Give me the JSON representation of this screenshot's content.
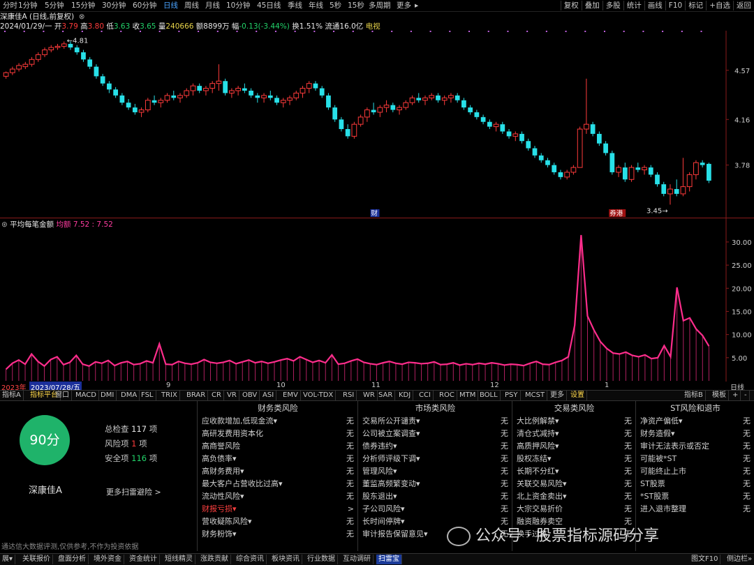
{
  "toolbar": {
    "periods": [
      "分时",
      "1分钟",
      "5分钟",
      "15分钟",
      "30分钟",
      "60分钟",
      "日线",
      "周线",
      "月线",
      "10分钟",
      "45日线",
      "季线",
      "年线",
      "5秒",
      "15秒",
      "多周期",
      "更多"
    ],
    "active_period": "日线",
    "right_tools": [
      "复权",
      "叠加",
      "多股",
      "统计",
      "画线",
      "F10",
      "标记",
      "+自选",
      "返回"
    ]
  },
  "stock": {
    "title": "深康佳A (日线,前复权)",
    "date": "2024/01/29/一",
    "open_label": "开",
    "open": "3.79",
    "high_label": "高",
    "high": "3.80",
    "low_label": "低",
    "low": "3.63",
    "close_label": "收",
    "close": "3.65",
    "vol_label": "量",
    "vol": "240666",
    "amount_label": "额",
    "amount": "8899万",
    "change_label": "幅",
    "change": "-0.13(-3.44%)",
    "turnover_label": "换",
    "turnover": "1.51%",
    "float_label": "流通",
    "float": "16.0亿",
    "news": "电视"
  },
  "price_panel": {
    "axis_labels": [
      "4.57",
      "4.16",
      "3.78"
    ],
    "high_mark": "4.81",
    "low_mark": "3.45",
    "event_tags": [
      "财",
      "券港"
    ]
  },
  "indicator": {
    "name": "平均每笔金额",
    "series_label": "均额",
    "values_text": "7.52 : 7.52",
    "axis_labels": [
      "30.00",
      "25.00",
      "20.00",
      "15.00",
      "10.00",
      "5.00"
    ]
  },
  "date_bar": {
    "year_label": "2023年",
    "cursor_date": "2023/07/28/五",
    "month_labels": [
      "9",
      "10",
      "11",
      "12",
      "1"
    ],
    "right_label": "日线"
  },
  "indicator_tabs": [
    "指标A",
    "指标平台",
    "窗口",
    "MACD",
    "DMI",
    "DMA",
    "FSL",
    "TRIX",
    "BRAR",
    "CR",
    "VR",
    "OBV",
    "ASI",
    "EMV",
    "VOL-TDX",
    "RSI",
    "WR",
    "SAR",
    "KDJ",
    "CCI",
    "ROC",
    "MTM",
    "BOLL",
    "PSY",
    "MCST",
    "更多",
    "设置"
  ],
  "indicator_tabs_right": [
    "指标B",
    "模板",
    "+",
    "-"
  ],
  "scan_summary": {
    "score": "90分",
    "name": "深康佳A",
    "total_label": "总检查",
    "total_value": "117",
    "total_unit": "项",
    "risk_label": "风险项",
    "risk_value": "1",
    "risk_unit": "项",
    "safe_label": "安全项",
    "safe_value": "116",
    "safe_unit": "项",
    "more_link": "更多扫雷避险 >"
  },
  "scan_columns": [
    {
      "title": "财务类风险",
      "rows": [
        {
          "label": "应收款增加,低现金流▾",
          "value": "无"
        },
        {
          "label": "高研发费用资本化",
          "value": "无"
        },
        {
          "label": "高商誉风险",
          "value": "无"
        },
        {
          "label": "高负债率▾",
          "value": "无"
        },
        {
          "label": "高财务费用▾",
          "value": "无"
        },
        {
          "label": "最大客户占营收比过高▾",
          "value": "无"
        },
        {
          "label": "流动性风险▾",
          "value": "无"
        },
        {
          "label": "财报亏损▾",
          "value": ">",
          "risk": true
        },
        {
          "label": "营收疑陈风险▾",
          "value": "无"
        },
        {
          "label": "财务粉饰▾",
          "value": "无"
        }
      ]
    },
    {
      "title": "市场类风险",
      "rows": [
        {
          "label": "交易所公开谴责▾",
          "value": "无"
        },
        {
          "label": "公司被立案调查▾",
          "value": "无"
        },
        {
          "label": "债券违约▾",
          "value": "无"
        },
        {
          "label": "分析师评级下调▾",
          "value": "无"
        },
        {
          "label": "管理风险▾",
          "value": "无"
        },
        {
          "label": "董监高频繁变动▾",
          "value": "无"
        },
        {
          "label": "股东退出▾",
          "value": "无"
        },
        {
          "label": "子公司风险▾",
          "value": "无"
        },
        {
          "label": "长时间停牌▾",
          "value": "无"
        },
        {
          "label": "审计报告保留意见▾",
          "value": "无"
        }
      ]
    },
    {
      "title": "交易类风险",
      "rows": [
        {
          "label": "大比例解禁▾",
          "value": "无"
        },
        {
          "label": "清仓式减持▾",
          "value": "无"
        },
        {
          "label": "高质押风险▾",
          "value": "无"
        },
        {
          "label": "股权冻结▾",
          "value": "无"
        },
        {
          "label": "长期不分红▾",
          "value": "无"
        },
        {
          "label": "关联交易风险▾",
          "value": "无"
        },
        {
          "label": "北上资金卖出▾",
          "value": "无"
        },
        {
          "label": "大宗交易折价",
          "value": "无"
        },
        {
          "label": "融资融券卖空",
          "value": "无"
        },
        {
          "label": "换手过高",
          "value": "无"
        }
      ]
    },
    {
      "title": "ST风险和退市",
      "rows": [
        {
          "label": "净资产偏低▾",
          "value": "无"
        },
        {
          "label": "财务造假▾",
          "value": "无"
        },
        {
          "label": "审计无法表示或否定",
          "value": "无"
        },
        {
          "label": "可能被*ST",
          "value": "无"
        },
        {
          "label": "可能终止上市",
          "value": "无"
        },
        {
          "label": "ST股票",
          "value": "无"
        },
        {
          "label": "*ST股票",
          "value": "无"
        },
        {
          "label": "进入退市整理",
          "value": "无"
        }
      ]
    }
  ],
  "disclaimer": "通达信大数据评测,仅供参考,不作为投资依据",
  "watermark": "公众号 · 股票指标源码分享",
  "bottom_tabs": [
    "展▾",
    "关联报价",
    "盘面分析",
    "境外资金",
    "资金统计",
    "短线精灵",
    "涨跌贡献",
    "综合资讯",
    "板块资讯",
    "行业数据",
    "互动调研",
    "扫雷宝"
  ],
  "bottom_right": [
    "图文F10",
    "侧边栏»"
  ],
  "colors": {
    "up": "#ff3b3b",
    "down": "#28e0e8",
    "indicator": "#ff2d8c",
    "score_circle": "#1fb36a"
  },
  "chart_data": [
    {
      "type": "candlestick",
      "title": "深康佳A (日线,前复权)",
      "ylim": [
        3.4,
        4.9
      ],
      "y_ticks": [
        4.57,
        4.16,
        3.78
      ],
      "annotations": [
        {
          "text": "4.81",
          "type": "high"
        },
        {
          "text": "3.45",
          "type": "low"
        }
      ],
      "ohlc": [
        [
          4.52,
          4.56,
          4.5,
          4.55
        ],
        [
          4.55,
          4.6,
          4.53,
          4.58
        ],
        [
          4.58,
          4.63,
          4.56,
          4.61
        ],
        [
          4.6,
          4.64,
          4.58,
          4.62
        ],
        [
          4.62,
          4.68,
          4.6,
          4.66
        ],
        [
          4.66,
          4.72,
          4.64,
          4.7
        ],
        [
          4.7,
          4.76,
          4.68,
          4.74
        ],
        [
          4.74,
          4.78,
          4.72,
          4.76
        ],
        [
          4.76,
          4.79,
          4.74,
          4.77
        ],
        [
          4.77,
          4.81,
          4.75,
          4.79
        ],
        [
          4.79,
          4.81,
          4.74,
          4.76
        ],
        [
          4.76,
          4.78,
          4.7,
          4.72
        ],
        [
          4.72,
          4.74,
          4.64,
          4.66
        ],
        [
          4.66,
          4.68,
          4.58,
          4.6
        ],
        [
          4.6,
          4.62,
          4.5,
          4.52
        ],
        [
          4.52,
          4.54,
          4.44,
          4.46
        ],
        [
          4.46,
          4.48,
          4.38,
          4.41
        ],
        [
          4.41,
          4.43,
          4.34,
          4.36
        ],
        [
          4.36,
          4.38,
          4.28,
          4.3
        ],
        [
          4.3,
          4.33,
          4.24,
          4.26
        ],
        [
          4.26,
          4.29,
          4.2,
          4.22
        ],
        [
          4.22,
          4.26,
          4.18,
          4.24
        ],
        [
          4.24,
          4.34,
          4.22,
          4.32
        ],
        [
          4.32,
          4.36,
          4.28,
          4.3
        ],
        [
          4.3,
          4.34,
          4.26,
          4.32
        ],
        [
          4.32,
          4.38,
          4.3,
          4.36
        ],
        [
          4.36,
          4.4,
          4.32,
          4.34
        ],
        [
          4.34,
          4.38,
          4.3,
          4.36
        ],
        [
          4.36,
          4.42,
          4.34,
          4.4
        ],
        [
          4.4,
          4.46,
          4.36,
          4.44
        ],
        [
          4.44,
          4.46,
          4.38,
          4.4
        ],
        [
          4.4,
          4.44,
          4.36,
          4.42
        ],
        [
          4.42,
          4.48,
          4.38,
          4.46
        ],
        [
          4.46,
          4.62,
          4.4,
          4.48
        ],
        [
          4.48,
          4.5,
          4.36,
          4.38
        ],
        [
          4.38,
          4.42,
          4.34,
          4.4
        ],
        [
          4.4,
          4.44,
          4.36,
          4.42
        ],
        [
          4.42,
          4.46,
          4.38,
          4.4
        ],
        [
          4.4,
          4.42,
          4.34,
          4.36
        ],
        [
          4.36,
          4.38,
          4.3,
          4.34
        ],
        [
          4.34,
          4.38,
          4.3,
          4.36
        ],
        [
          4.36,
          4.4,
          4.32,
          4.34
        ],
        [
          4.34,
          4.36,
          4.28,
          4.3
        ],
        [
          4.3,
          4.34,
          4.26,
          4.32
        ],
        [
          4.32,
          4.36,
          4.28,
          4.34
        ],
        [
          4.34,
          4.4,
          4.32,
          4.38
        ],
        [
          4.38,
          4.44,
          4.34,
          4.42
        ],
        [
          4.42,
          4.48,
          4.38,
          4.46
        ],
        [
          4.46,
          4.48,
          4.4,
          4.42
        ],
        [
          4.42,
          4.44,
          4.34,
          4.36
        ],
        [
          4.36,
          4.38,
          4.24,
          4.26
        ],
        [
          4.26,
          4.28,
          4.14,
          4.16
        ],
        [
          4.16,
          4.18,
          4.06,
          4.08
        ],
        [
          4.08,
          4.12,
          4.0,
          4.02
        ],
        [
          4.02,
          4.14,
          4.0,
          4.12
        ],
        [
          4.12,
          4.2,
          4.1,
          4.18
        ],
        [
          4.18,
          4.26,
          4.14,
          4.24
        ],
        [
          4.24,
          4.3,
          4.2,
          4.22
        ],
        [
          4.22,
          4.28,
          4.18,
          4.26
        ],
        [
          4.26,
          4.32,
          4.22,
          4.28
        ],
        [
          4.28,
          4.3,
          4.22,
          4.24
        ],
        [
          4.24,
          4.28,
          4.2,
          4.26
        ],
        [
          4.26,
          4.32,
          4.24,
          4.3
        ],
        [
          4.3,
          4.36,
          4.28,
          4.34
        ],
        [
          4.34,
          4.38,
          4.3,
          4.32
        ],
        [
          4.32,
          4.36,
          4.28,
          4.34
        ],
        [
          4.34,
          4.38,
          4.32,
          4.36
        ],
        [
          4.36,
          4.38,
          4.3,
          4.32
        ],
        [
          4.32,
          4.36,
          4.28,
          4.34
        ],
        [
          4.34,
          4.38,
          4.3,
          4.36
        ],
        [
          4.36,
          4.38,
          4.3,
          4.32
        ],
        [
          4.32,
          4.34,
          4.24,
          4.26
        ],
        [
          4.26,
          4.28,
          4.2,
          4.22
        ],
        [
          4.22,
          4.24,
          4.16,
          4.18
        ],
        [
          4.18,
          4.2,
          4.12,
          4.14
        ],
        [
          4.14,
          4.16,
          4.08,
          4.1
        ],
        [
          4.1,
          4.14,
          4.06,
          4.12
        ],
        [
          4.12,
          4.14,
          4.04,
          4.06
        ],
        [
          4.06,
          4.08,
          4.0,
          4.02
        ],
        [
          4.02,
          4.06,
          3.98,
          4.04
        ],
        [
          4.04,
          4.06,
          3.96,
          3.98
        ],
        [
          3.98,
          4.0,
          3.9,
          3.92
        ],
        [
          3.92,
          3.94,
          3.84,
          3.86
        ],
        [
          3.86,
          3.88,
          3.8,
          3.82
        ],
        [
          3.82,
          3.84,
          3.76,
          3.78
        ],
        [
          3.78,
          3.8,
          3.7,
          3.72
        ],
        [
          3.72,
          3.74,
          3.66,
          3.68
        ],
        [
          3.68,
          3.74,
          3.66,
          3.72
        ],
        [
          3.72,
          3.78,
          3.7,
          3.76
        ],
        [
          3.76,
          4.1,
          3.76,
          4.08
        ],
        [
          4.08,
          4.5,
          4.04,
          4.12
        ],
        [
          4.12,
          4.14,
          4.02,
          4.04
        ],
        [
          4.04,
          4.06,
          3.94,
          3.96
        ],
        [
          3.96,
          3.98,
          3.86,
          3.88
        ],
        [
          3.88,
          3.9,
          3.7,
          3.72
        ],
        [
          3.72,
          3.78,
          3.68,
          3.76
        ],
        [
          3.76,
          3.8,
          3.64,
          3.66
        ],
        [
          3.66,
          3.78,
          3.64,
          3.76
        ],
        [
          3.76,
          3.8,
          3.72,
          3.74
        ],
        [
          3.74,
          3.78,
          3.7,
          3.76
        ],
        [
          3.76,
          3.78,
          3.68,
          3.7
        ],
        [
          3.7,
          3.72,
          3.6,
          3.62
        ],
        [
          3.62,
          3.64,
          3.52,
          3.54
        ],
        [
          3.54,
          3.62,
          3.45,
          3.58
        ],
        [
          3.58,
          3.66,
          3.52,
          3.54
        ],
        [
          3.54,
          3.84,
          3.52,
          3.6
        ],
        [
          3.6,
          3.72,
          3.56,
          3.7
        ],
        [
          3.7,
          3.82,
          3.66,
          3.8
        ],
        [
          3.8,
          3.82,
          3.76,
          3.78
        ],
        [
          3.79,
          3.8,
          3.63,
          3.65
        ]
      ]
    },
    {
      "type": "line",
      "title": "平均每笔金额",
      "series": [
        {
          "name": "均额",
          "values": [
            2.5,
            3.8,
            4.5,
            3.6,
            5.8,
            4.2,
            3.2,
            4.6,
            5.2,
            3.5,
            4.0,
            5.5,
            3.6,
            3.2,
            4.1,
            3.8,
            4.4,
            3.3,
            3.9,
            4.2,
            3.5,
            3.7,
            4.3,
            3.9,
            8.0,
            3.6,
            3.5,
            4.2,
            3.8,
            3.6,
            3.9,
            4.6,
            4.0,
            3.8,
            4.0,
            4.4,
            3.7,
            4.1,
            4.5,
            3.9,
            4.2,
            3.8,
            4.1,
            4.5,
            4.8,
            4.3,
            5.2,
            4.6,
            4.0,
            4.4,
            3.9,
            5.6,
            3.6,
            3.8,
            4.3,
            4.7,
            4.0,
            3.7,
            3.5,
            3.9,
            4.2,
            3.8,
            3.6,
            4.0,
            3.9,
            3.7,
            3.8,
            4.1,
            3.5,
            3.6,
            3.9,
            3.4,
            3.7,
            3.5,
            3.8,
            3.6,
            3.9,
            3.7,
            3.4,
            3.6,
            3.5,
            3.3,
            3.8,
            4.2,
            3.6,
            3.5,
            4.0,
            4.4,
            5.2,
            12.0,
            31.5,
            14.0,
            11.0,
            8.5,
            7.0,
            6.0,
            5.8,
            6.2,
            5.5,
            5.2,
            5.6,
            4.8,
            5.0,
            7.6,
            5.2,
            20.2,
            13.0,
            13.6,
            11.2,
            9.8,
            7.5
          ]
        }
      ],
      "ylim": [
        0,
        33
      ],
      "y_ticks": [
        30,
        25,
        20,
        15,
        10,
        5
      ]
    }
  ]
}
